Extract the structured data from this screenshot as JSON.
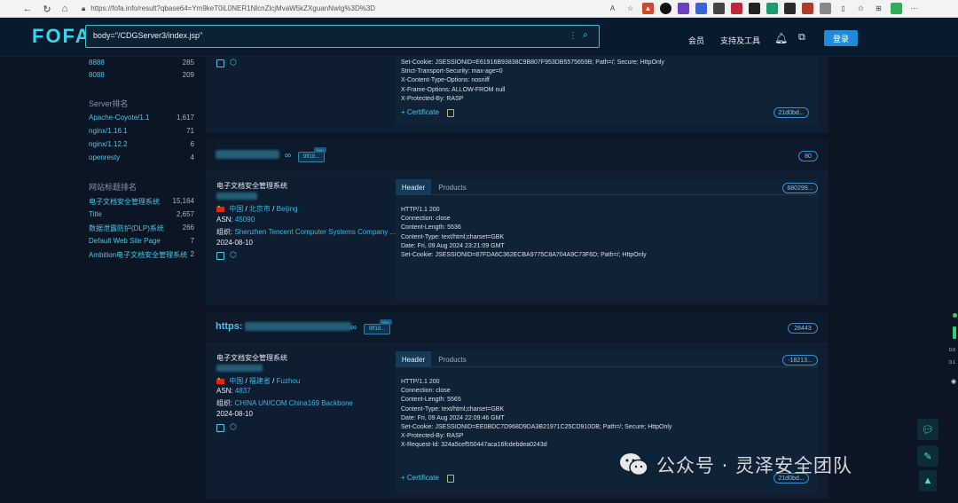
{
  "browser": {
    "url": "https://fofa.info/result?qbase64=Ym9keT0iL0NER1NlcnZlcjMvaW5kZXguanNwIg%3D%3D"
  },
  "header": {
    "logo": "FOFA",
    "search_value": "body=\"/CDGServer3/index.jsp\"",
    "nav_member": "会员",
    "nav_tools": "支持及工具",
    "login": "登录"
  },
  "sidebar": {
    "ports": [
      {
        "name": "8888",
        "count": "285"
      },
      {
        "name": "8088",
        "count": "209"
      }
    ],
    "server_title": "Server排名",
    "servers": [
      {
        "name": "Apache-Coyote/1.1",
        "count": "1,617"
      },
      {
        "name": "nginx/1.16.1",
        "count": "71"
      },
      {
        "name": "nginx/1.12.2",
        "count": "6"
      },
      {
        "name": "openresty",
        "count": "4"
      }
    ],
    "title_title": "网站标题排名",
    "titles": [
      {
        "name": "电子文档安全管理系统",
        "count": "15,164"
      },
      {
        "name": "Title",
        "count": "2,657"
      },
      {
        "name": "数据泄露防护(DLP)系统",
        "count": "266"
      },
      {
        "name": "Default Web Site Page",
        "count": "7"
      },
      {
        "name": "Ambition电子文档安全管理系统",
        "count": "2"
      }
    ]
  },
  "card0": {
    "headers": "Set-Cookie: JSESSIONID=E61916B93838C9B807F953DB5575659B; Path=/; Secure; HttpOnly\nStrict-Transport-Security: max-age=0\nX-Content-Type-Options: nosniff\nX-Frame-Options: ALLOW-FROM null\nX-Protected-By: RASP",
    "certificate": "Certificate",
    "hash": "21d0bd..."
  },
  "card1": {
    "badge": "9ff18...",
    "badge_sup": "999+",
    "port": "80",
    "title": "电子文档安全管理系统",
    "country": "中国",
    "region": "北京市",
    "city": "Beijing",
    "asn_label": "ASN:",
    "asn": "45090",
    "org_label": "组织:",
    "org": "Shenzhen Tencent Computer Systems Company ...",
    "date": "2024-08-10",
    "tab_header": "Header",
    "tab_products": "Products",
    "hash": "680299...",
    "headers": "HTTP/1.1 200\nConnection: close\nContent-Length: 5536\nContent-Type: text/html;charset=GBK\nDate: Fri, 09 Aug 2024 23:21:09 GMT\nSet-Cookie: JSESSIONID=87FDA6C362ECBA9775C8A704A9C73F6D; Path=/; HttpOnly"
  },
  "card2": {
    "host_prefix": "https:",
    "badge": "9ff18...",
    "badge_sup": "999+",
    "port": "28443",
    "title": "电子文档安全管理系统",
    "country": "中国",
    "region": "福建省",
    "city": "Fuzhou",
    "asn_label": "ASN:",
    "asn": "4837",
    "org_label": "组织:",
    "org": "CHINA UNICOM China169 Backbone",
    "date": "2024-08-10",
    "tab_header": "Header",
    "tab_products": "Products",
    "hash": "-18213...",
    "headers": "HTTP/1.1 200\nConnection: close\nContent-Length: 5565\nContent-Type: text/html;charset=GBK\nDate: Fri, 09 Aug 2024 22:09:46 GMT\nSet-Cookie: JSESSIONID=EE0BDC7D968D9DA3B21971C25CD910DB; Path=/; Secure; HttpOnly\nX-Protected-By: RASP\nX-Request-Id: 324a5cef550447aca16fcdebdea0243d",
    "certificate": "Certificate",
    "cert_hash": "21d0bd..."
  },
  "rail": {
    "v1": "0.0",
    "v2": "0.1"
  },
  "watermark": "公众号 · 灵泽安全团队",
  "colors": {
    "accent": "#36d6e7",
    "link": "#4cc8e6",
    "background": "#0b1524",
    "login": "#1f8bd9"
  }
}
